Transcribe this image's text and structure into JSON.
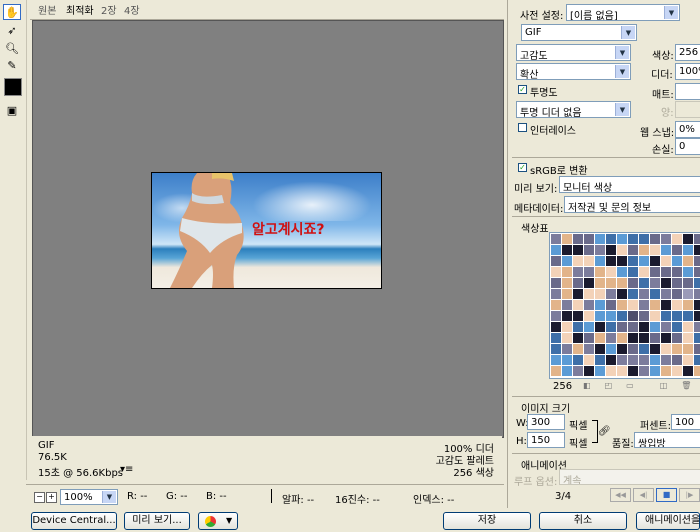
{
  "tabs": [
    "원본",
    "최적화",
    "2장",
    "4장"
  ],
  "active_tab": 1,
  "image_overlay_text": "알고계시죠?",
  "info_left": [
    "GIF",
    "76.5K",
    "15초 @ 56.6Kbps"
  ],
  "info_left_menu": "▾≡",
  "info_right": [
    "100% 디더",
    "고감도 팔레트",
    "256 색상"
  ],
  "statusbar": {
    "zoom": "100%",
    "r": "R: --",
    "g": "G: --",
    "b": "B: --",
    "alpha": "알파: --",
    "hex": "16진수: --",
    "index": "인덱스: --"
  },
  "bottom_buttons": {
    "device_central": "Device Central...",
    "preview": "미리 보기...",
    "save": "저장",
    "cancel": "취소",
    "done": "애니메이션을"
  },
  "settings": {
    "preset_label": "사전 설정:",
    "preset_value": "[이름 없음]",
    "format": "GIF",
    "reduction": "고감도",
    "colors_label": "색상:",
    "colors_value": "256",
    "dither_algo": "확산",
    "dither_label": "디더:",
    "dither_value": "100%",
    "transparency_label": "투명도",
    "matte_label": "매트:",
    "trans_dither": "투명 디더 없음",
    "amount_label": "양:",
    "interlace_label": "인터레이스",
    "websnap_label": "웹 스냅:",
    "websnap_value": "0%",
    "lossy_label": "손실:",
    "lossy_value": "0",
    "srgb_label": "sRGB로 변환",
    "preview_label": "미리 보기:",
    "preview_value": "모니터 색상",
    "metadata_label": "메타데이터:",
    "metadata_value": "저작권 및 문의 정보"
  },
  "color_table": {
    "title": "색상표",
    "count": "256"
  },
  "image_size": {
    "title": "이미지 크기",
    "w_label": "W:",
    "w_value": "300",
    "h_label": "H:",
    "h_value": "150",
    "unit": "픽셀",
    "percent_label": "퍼센트:",
    "percent_value": "100",
    "quality_label": "품질:",
    "quality_value": "쌍입방"
  },
  "animation": {
    "title": "애니메이션",
    "loop_label": "루프 옵션:",
    "loop_value": "계속",
    "frame": "3/4"
  }
}
